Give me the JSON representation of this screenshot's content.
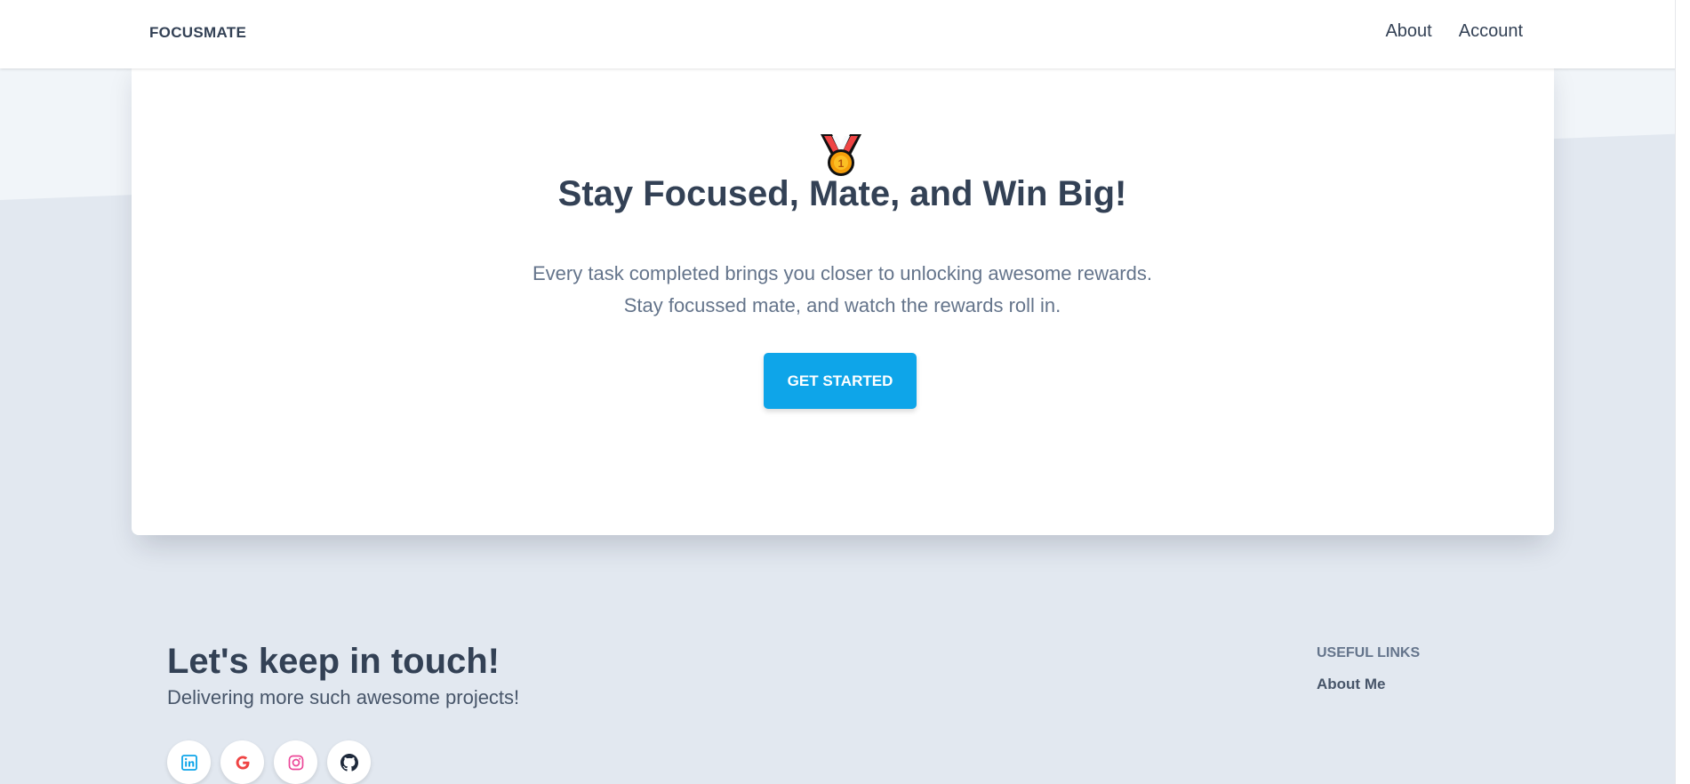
{
  "navbar": {
    "brand": "FOCUSMATE",
    "links": [
      {
        "label": "About"
      },
      {
        "label": "Account"
      }
    ]
  },
  "hero": {
    "icon": "medal-icon",
    "title": "Stay Focused, Mate, and Win Big!",
    "text_line1": "Every task completed brings you closer to unlocking awesome rewards.",
    "text_line2": "Stay focussed mate, and watch the rewards roll in.",
    "cta_label": "GET STARTED"
  },
  "footer": {
    "title": "Let's keep in touch!",
    "subtitle": "Delivering more such awesome projects!",
    "socials": [
      {
        "icon": "linkedin-icon",
        "color": "#0ea5e9"
      },
      {
        "icon": "google-icon",
        "color": "#ef4444"
      },
      {
        "icon": "instagram-icon",
        "color": "#ec4899"
      },
      {
        "icon": "github-icon",
        "color": "#1e293b"
      }
    ],
    "useful_links_heading": "USEFUL LINKS",
    "useful_links": [
      {
        "label": "About Me"
      }
    ]
  },
  "colors": {
    "accent": "#0ea5e9",
    "text": "#334155",
    "muted": "#64748b",
    "page_bg": "#e2e8f0"
  }
}
